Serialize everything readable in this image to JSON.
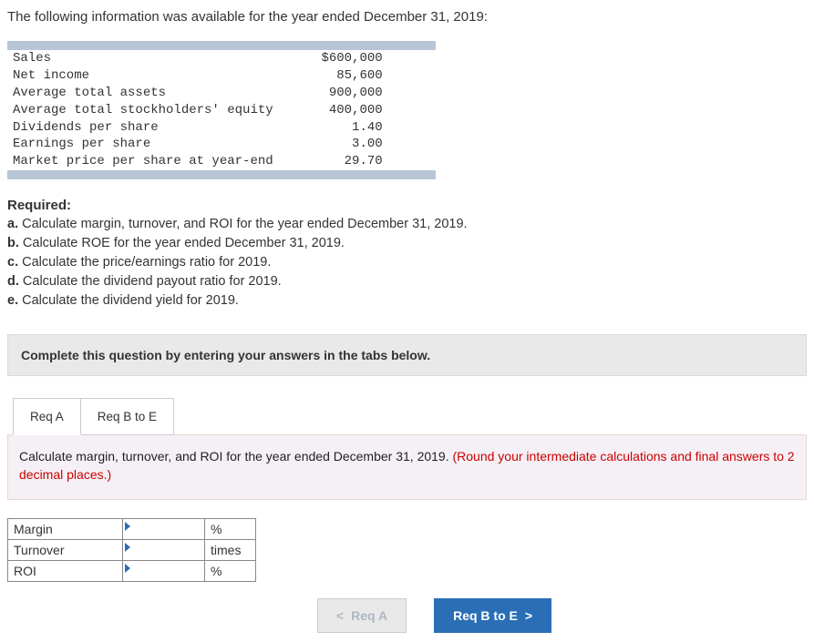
{
  "intro": "The following information was available for the year ended December 31, 2019:",
  "data_rows": [
    {
      "label": "Sales",
      "value": "$600,000"
    },
    {
      "label": "Net income",
      "value": "85,600"
    },
    {
      "label": "Average total assets",
      "value": "900,000"
    },
    {
      "label": "Average total stockholders' equity",
      "value": "400,000"
    },
    {
      "label": "Dividends per share",
      "value": "1.40"
    },
    {
      "label": "Earnings per share",
      "value": "3.00"
    },
    {
      "label": "Market price per share at year-end",
      "value": "29.70"
    }
  ],
  "required": {
    "header": "Required:",
    "items": [
      {
        "tag": "a.",
        "text": "Calculate margin, turnover, and ROI for the year ended December 31, 2019."
      },
      {
        "tag": "b.",
        "text": "Calculate ROE for the year ended December 31, 2019."
      },
      {
        "tag": "c.",
        "text": "Calculate the price/earnings ratio for 2019."
      },
      {
        "tag": "d.",
        "text": "Calculate the dividend payout ratio for 2019."
      },
      {
        "tag": "e.",
        "text": "Calculate the dividend yield for 2019."
      }
    ]
  },
  "instruction": "Complete this question by entering your answers in the tabs below.",
  "tabs": {
    "a": "Req A",
    "b": "Req B to E"
  },
  "panel": {
    "black": "Calculate margin, turnover, and ROI for the year ended December 31, 2019. ",
    "red": "(Round your intermediate calculations and final answers to 2 decimal places.)"
  },
  "answer_rows": [
    {
      "label": "Margin",
      "unit": "%"
    },
    {
      "label": "Turnover",
      "unit": "times"
    },
    {
      "label": "ROI",
      "unit": "%"
    }
  ],
  "nav": {
    "prev": "Req A",
    "next": "Req B to E",
    "chev_left": "<",
    "chev_right": ">"
  }
}
